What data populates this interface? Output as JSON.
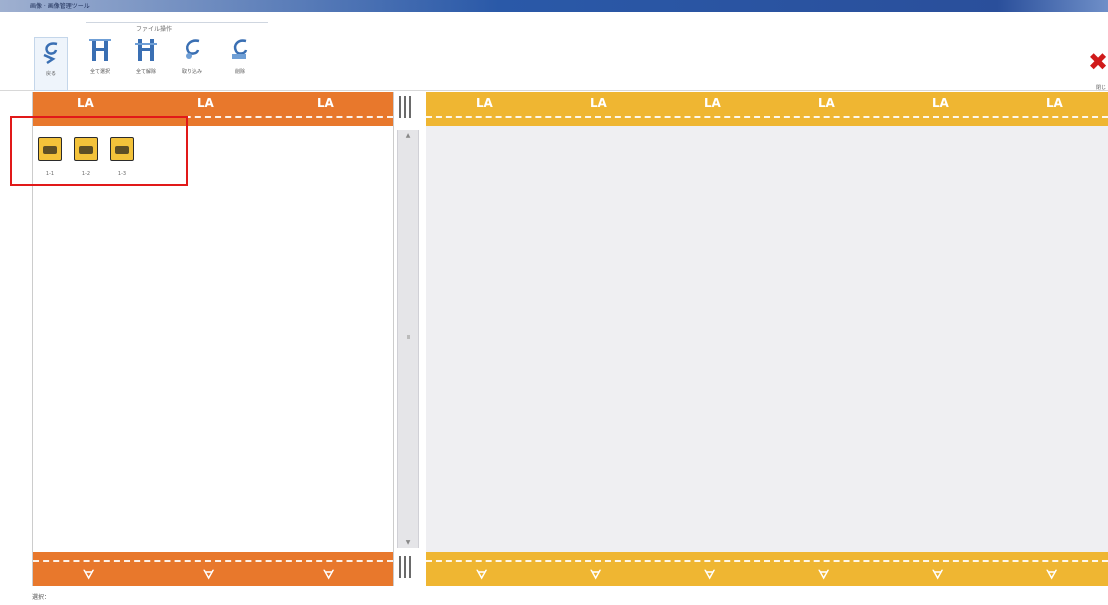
{
  "window": {
    "title": "画像 · 画像管理ツール"
  },
  "ribbon": {
    "group_label": "ファイル操作",
    "tools": [
      {
        "label": "戻る",
        "icon": "back-arrow-icon"
      },
      {
        "label": "全て選択",
        "icon": "select-all-icon"
      },
      {
        "label": "全て解除",
        "icon": "deselect-all-icon"
      },
      {
        "label": "取り込み",
        "icon": "import-icon"
      },
      {
        "label": "削除",
        "icon": "delete-icon"
      }
    ],
    "close_label": "閉じる"
  },
  "left_pane": {
    "thumbnails": [
      {
        "caption": "1-1"
      },
      {
        "caption": "1-2"
      },
      {
        "caption": "1-3"
      }
    ]
  },
  "status_bar": {
    "text": "選択："
  },
  "colors": {
    "left_film": "#e8782c",
    "right_film": "#efb632",
    "highlight_box": "#e11919",
    "right_bg": "#efeff2"
  }
}
